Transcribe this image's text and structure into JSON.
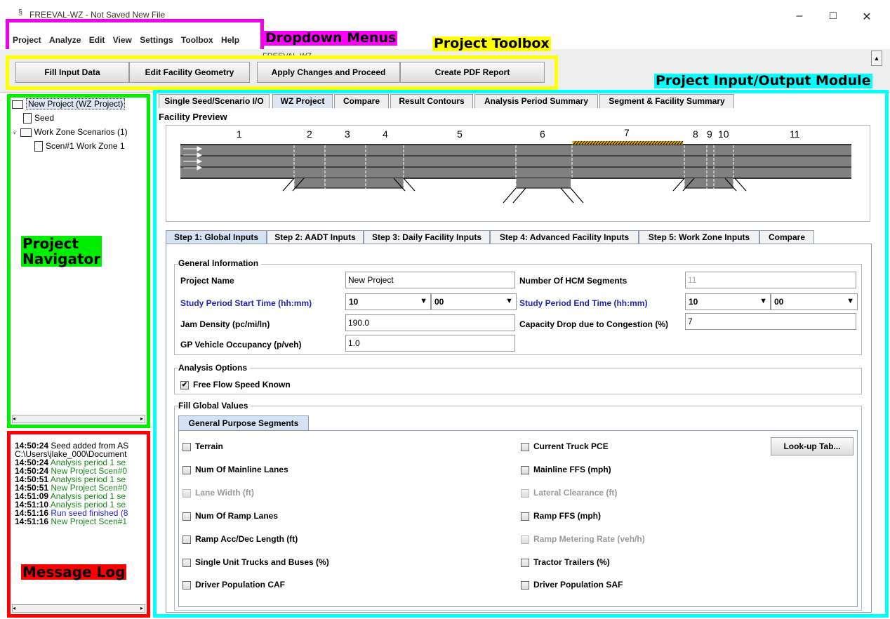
{
  "window": {
    "title": "FREEVAL-WZ - Not Saved New File",
    "min": "–",
    "max": "□",
    "close": "✕"
  },
  "menu": [
    "Project",
    "Analyze",
    "Edit",
    "View",
    "Settings",
    "Toolbox",
    "Help"
  ],
  "toolbar": {
    "project_label": "FREEVAL-WZ",
    "buttons": [
      "Fill Input Data",
      "Edit Facility Geometry",
      "Apply Changes and Proceed",
      "Create PDF Report"
    ]
  },
  "annotations": {
    "dropdown_menus": "Dropdown Menus",
    "project_toolbox": "Project Toolbox",
    "io_module": "Project Input/Output Module",
    "navigator": "Project\nNavigator",
    "message_log": "Message Log"
  },
  "navigator": {
    "root": "New Project (WZ Project)",
    "seed": "Seed",
    "scenarios": "Work Zone Scenarios (1)",
    "scenario_1": "Scen#1 Work Zone 1"
  },
  "log": [
    {
      "time": "14:50:24",
      "text": " Seed added from AS",
      "color": "#000000"
    },
    {
      "time": "",
      "text": "C:\\Users\\jlake_000\\Document",
      "color": "#000000"
    },
    {
      "time": "14:50:24",
      "text": " Analysis period 1 se",
      "color": "#1a8a1a"
    },
    {
      "time": "14:50:24",
      "text": " New Project Scen#0",
      "color": "#1a8a1a"
    },
    {
      "time": "14:50:51",
      "text": " Analysis period 1 se",
      "color": "#1a8a1a"
    },
    {
      "time": "14:50:51",
      "text": " New Project Scen#0",
      "color": "#1a8a1a"
    },
    {
      "time": "14:51:09",
      "text": " Analysis period 1 se",
      "color": "#1a8a1a"
    },
    {
      "time": "14:51:10",
      "text": " Analysis period 1 se",
      "color": "#1a8a1a"
    },
    {
      "time": "14:51:16",
      "text": " Run seed finished (8",
      "color": "#1f1fcc"
    },
    {
      "time": "14:51:16",
      "text": " New Project Scen#1",
      "color": "#1a8a1a"
    }
  ],
  "main_tabs": [
    "Single Seed/Scenario I/O",
    "WZ Project",
    "Compare",
    "Result Contours",
    "Analysis Period Summary",
    "Segment & Facility Summary"
  ],
  "active_main_tab": "WZ Project",
  "preview": {
    "title": "Facility Preview",
    "segments": [
      "1",
      "2",
      "3",
      "4",
      "5",
      "6",
      "7",
      "8",
      "9",
      "10",
      "11"
    ]
  },
  "step_tabs": [
    "Step 1: Global Inputs",
    "Step 2: AADT Inputs",
    "Step 3: Daily Facility Inputs",
    "Step 4: Advanced Facility Inputs",
    "Step 5: Work Zone Inputs",
    "Compare"
  ],
  "active_step_tab": "Step 1: Global Inputs",
  "general_info": {
    "title": "General Information",
    "project_name_label": "Project Name",
    "project_name": "New Project",
    "hcm_segments_label": "Number Of HCM Segments",
    "hcm_segments": "11",
    "start_label": "Study Period Start Time (hh:mm)",
    "start_hh": "10",
    "start_mm": "00",
    "end_label": "Study Period End Time (hh:mm)",
    "end_hh": "10",
    "end_mm": "00",
    "jam_label": "Jam Density (pc/mi/ln)",
    "jam": "190.0",
    "cap_drop_label": "Capacity Drop due to Congestion (%)",
    "cap_drop": "7",
    "occupancy_label": "GP Vehicle Occupancy (p/veh)",
    "occupancy": "1.0"
  },
  "analysis_options": {
    "title": "Analysis Options",
    "ffs_known": "Free Flow Speed Known",
    "ffs_checked": "✔"
  },
  "fill_global": {
    "title": "Fill Global Values",
    "tab": "General Purpose Segments",
    "left": [
      "Terrain",
      "Num Of Mainline Lanes",
      "Lane Width (ft)",
      "Num Of Ramp Lanes",
      "Ramp Acc/Dec Length (ft)",
      "Single Unit Trucks and Buses (%)",
      "Driver Population CAF"
    ],
    "right": [
      "Current Truck PCE",
      "Mainline FFS (mph)",
      "Lateral Clearance (ft)",
      "Ramp FFS (mph)",
      "Ramp Metering Rate (veh/h)",
      "Tractor Trailers (%)",
      "Driver Population SAF"
    ],
    "lookup": "Look-up Tab..."
  }
}
